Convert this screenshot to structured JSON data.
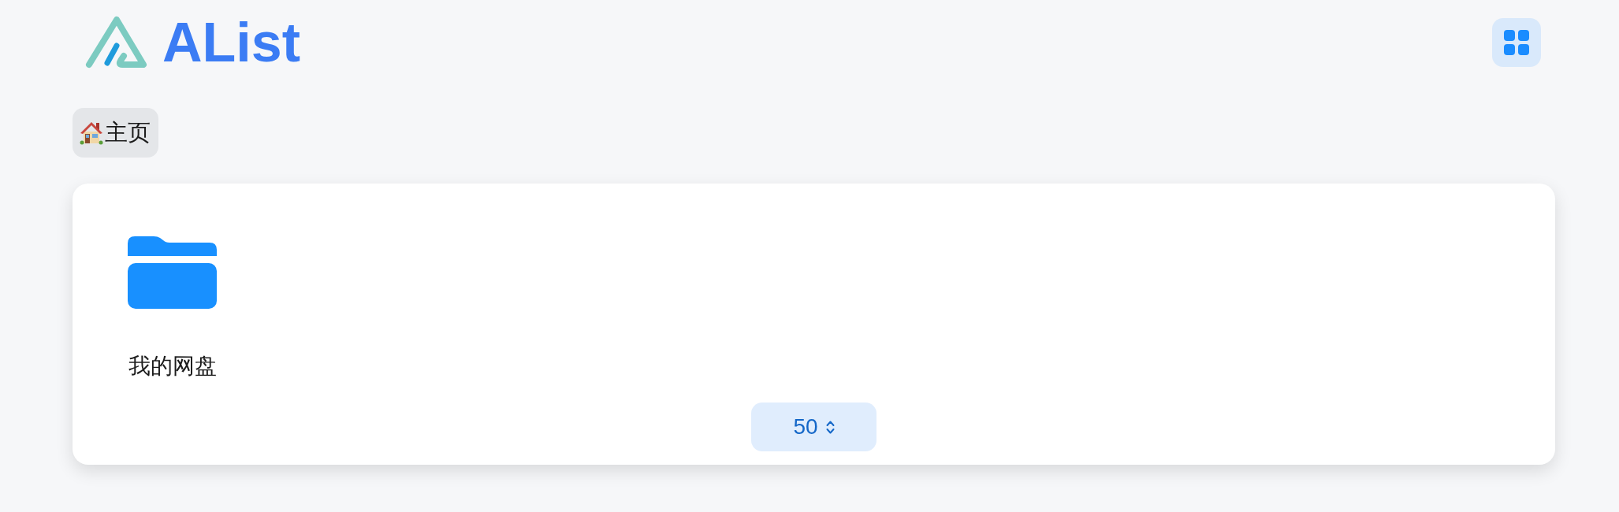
{
  "header": {
    "logo_text": "AList"
  },
  "breadcrumb": [
    {
      "label": "主页"
    }
  ],
  "files": [
    {
      "kind": "folder",
      "name": "我的网盘"
    }
  ],
  "pagination": {
    "page_size": "50"
  }
}
